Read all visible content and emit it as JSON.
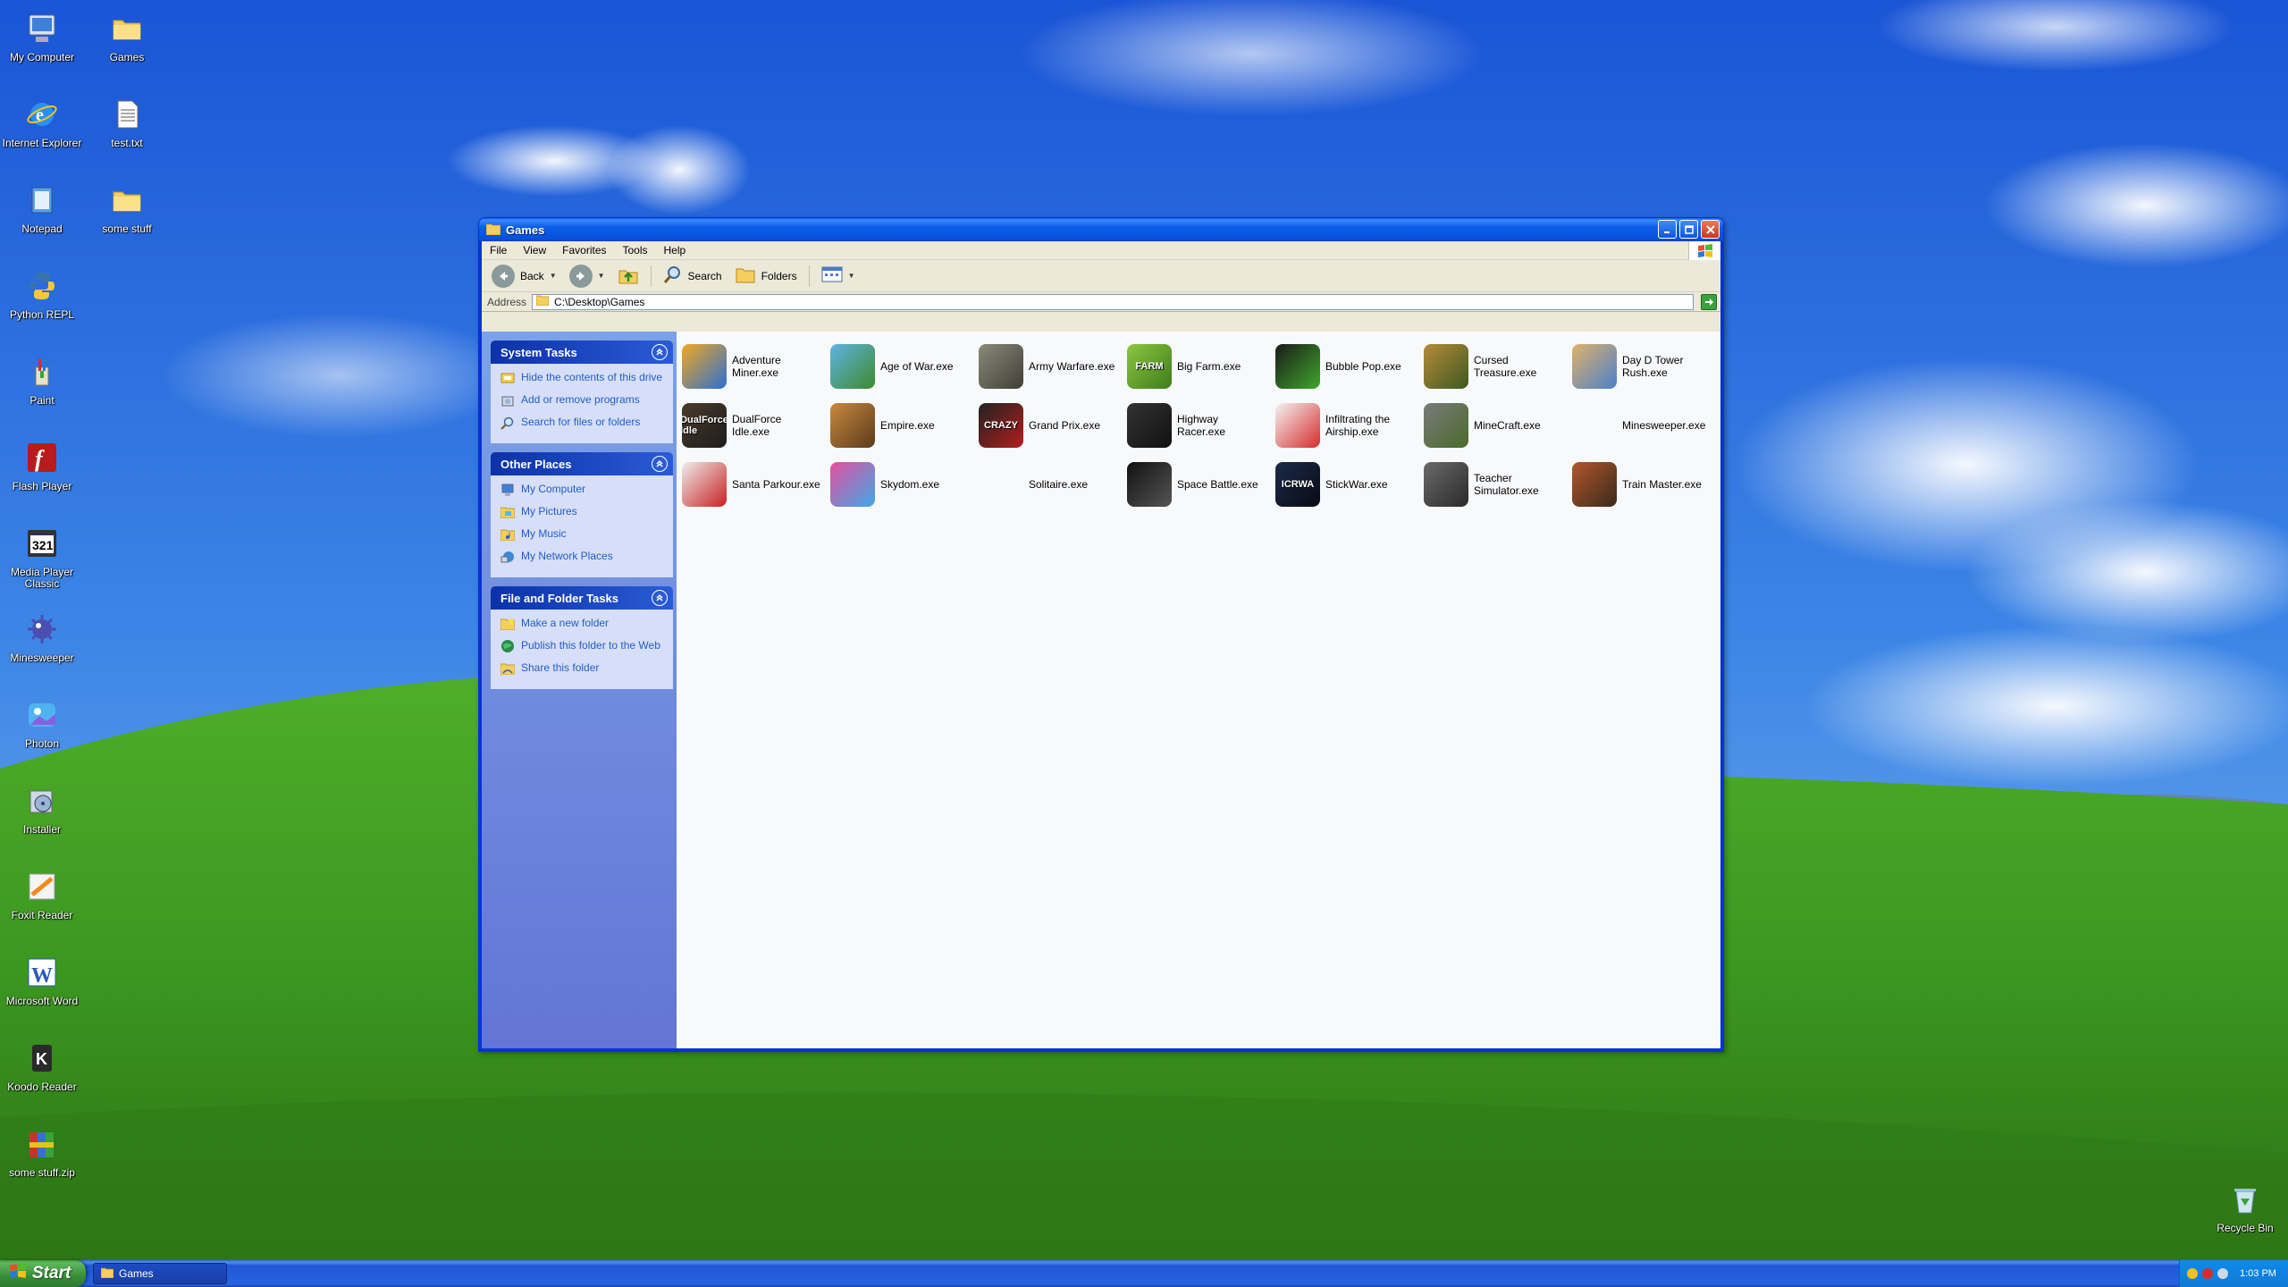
{
  "desktop": {
    "icons_left": [
      {
        "label": "My Computer",
        "icon": "my-computer-icon"
      },
      {
        "label": "Internet Explorer",
        "icon": "internet-explorer-icon"
      },
      {
        "label": "Notepad",
        "icon": "notepad-icon"
      },
      {
        "label": "Python REPL",
        "icon": "python-icon"
      },
      {
        "label": "Paint",
        "icon": "paint-icon"
      },
      {
        "label": "Flash Player",
        "icon": "flash-player-icon"
      },
      {
        "label": "Media Player Classic",
        "icon": "media-player-icon"
      },
      {
        "label": "Minesweeper",
        "icon": "minesweeper-icon"
      },
      {
        "label": "Photon",
        "icon": "photon-icon"
      },
      {
        "label": "Installer",
        "icon": "installer-icon"
      },
      {
        "label": "Foxit Reader",
        "icon": "foxit-reader-icon"
      },
      {
        "label": "Microsoft Word",
        "icon": "word-icon"
      },
      {
        "label": "Koodo Reader",
        "icon": "koodo-reader-icon"
      },
      {
        "label": "some stuff.zip",
        "icon": "zip-archive-icon"
      }
    ],
    "icons_second": [
      {
        "label": "Games",
        "icon": "folder-icon"
      },
      {
        "label": "test.txt",
        "icon": "text-file-icon"
      },
      {
        "label": "some stuff",
        "icon": "folder-icon"
      }
    ],
    "recycle_bin": "Recycle Bin"
  },
  "window": {
    "title": "Games",
    "menu": [
      "File",
      "View",
      "Favorites",
      "Tools",
      "Help"
    ],
    "toolbar": {
      "back": "Back",
      "search": "Search",
      "folders": "Folders"
    },
    "address": {
      "label": "Address",
      "path": "C:\\Desktop\\Games"
    },
    "task_panels": [
      {
        "title": "System Tasks",
        "links": [
          {
            "label": "Hide the contents of this drive",
            "icon": "hide-icon"
          },
          {
            "label": "Add or remove programs",
            "icon": "add-remove-icon"
          },
          {
            "label": "Search for files or folders",
            "icon": "search-icon"
          }
        ]
      },
      {
        "title": "Other Places",
        "links": [
          {
            "label": "My Computer",
            "icon": "my-computer-icon"
          },
          {
            "label": "My Pictures",
            "icon": "pictures-icon"
          },
          {
            "label": "My Music",
            "icon": "music-icon"
          },
          {
            "label": "My Network Places",
            "icon": "network-icon"
          }
        ]
      },
      {
        "title": "File and Folder Tasks",
        "links": [
          {
            "label": "Make a new folder",
            "icon": "new-folder-icon"
          },
          {
            "label": "Publish this folder to the Web",
            "icon": "globe-icon"
          },
          {
            "label": "Share this folder",
            "icon": "share-folder-icon"
          }
        ]
      }
    ],
    "files": [
      {
        "name": "Adventure Miner.exe",
        "thumb": "",
        "c1": "#f2a81d",
        "c2": "#2b6fd6"
      },
      {
        "name": "Age of War.exe",
        "thumb": "",
        "c1": "#5fb3e6",
        "c2": "#3d8a2b"
      },
      {
        "name": "Army Warfare.exe",
        "thumb": "",
        "c1": "#8a8a7a",
        "c2": "#3f3f36"
      },
      {
        "name": "Big Farm.exe",
        "thumb": "FARM",
        "c1": "#8cc63f",
        "c2": "#3e7d1c"
      },
      {
        "name": "Bubble Pop.exe",
        "thumb": "",
        "c1": "#1a1a1a",
        "c2": "#3fa82b"
      },
      {
        "name": "Cursed Treasure.exe",
        "thumb": "",
        "c1": "#b58b3a",
        "c2": "#3d5a1f"
      },
      {
        "name": "Day D Tower Rush.exe",
        "thumb": "",
        "c1": "#e0b26b",
        "c2": "#4a80c8"
      },
      {
        "name": "DualForce Idle.exe",
        "thumb": "DualForce Idle",
        "c1": "#4a3b2a",
        "c2": "#1d1d1d"
      },
      {
        "name": "Empire.exe",
        "thumb": "",
        "c1": "#c9893d",
        "c2": "#5a3b1c"
      },
      {
        "name": "Grand Prix.exe",
        "thumb": "CRAZY",
        "c1": "#222222",
        "c2": "#b21d1d"
      },
      {
        "name": "Highway Racer.exe",
        "thumb": "",
        "c1": "#333333",
        "c2": "#111111"
      },
      {
        "name": "Infiltrating the Airship.exe",
        "thumb": "",
        "c1": "#f4f4f4",
        "c2": "#d62c2c"
      },
      {
        "name": "MineCraft.exe",
        "thumb": "",
        "c1": "#7a7a7a",
        "c2": "#4a6b2a"
      },
      {
        "name": "Minesweeper.exe",
        "thumb": "",
        "c1": "#f8f9fb",
        "c2": "#f8f9fb"
      },
      {
        "name": "Santa Parkour.exe",
        "thumb": "",
        "c1": "#eeeeee",
        "c2": "#c82020"
      },
      {
        "name": "Skydom.exe",
        "thumb": "",
        "c1": "#e64fa0",
        "c2": "#3fa8e6"
      },
      {
        "name": "Solitaire.exe",
        "thumb": "",
        "c1": "#f8f9fb",
        "c2": "#f8f9fb"
      },
      {
        "name": "Space Battle.exe",
        "thumb": "",
        "c1": "#111111",
        "c2": "#555555"
      },
      {
        "name": "StickWar.exe",
        "thumb": "ICRWA",
        "c1": "#1a2a4a",
        "c2": "#0a0a14"
      },
      {
        "name": "Teacher Simulator.exe",
        "thumb": "",
        "c1": "#6a6a6a",
        "c2": "#2a2a2a"
      },
      {
        "name": "Train Master.exe",
        "thumb": "",
        "c1": "#b0572d",
        "c2": "#3a2a1a"
      }
    ]
  },
  "taskbar": {
    "start": "Start",
    "task": "Games",
    "clock": "1:03 PM"
  }
}
